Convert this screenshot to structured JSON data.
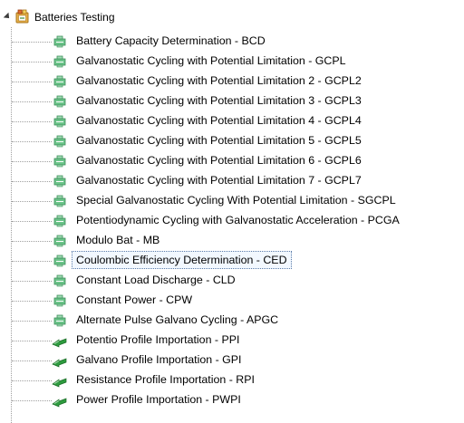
{
  "tree": {
    "root_label": "Batteries Testing",
    "items": [
      {
        "label": "Battery Capacity Determination - BCD",
        "icon": "technique-icon"
      },
      {
        "label": "Galvanostatic Cycling with Potential Limitation - GCPL",
        "icon": "technique-icon"
      },
      {
        "label": "Galvanostatic Cycling with Potential Limitation 2 - GCPL2",
        "icon": "technique-icon"
      },
      {
        "label": "Galvanostatic Cycling with Potential Limitation 3 - GCPL3",
        "icon": "technique-icon"
      },
      {
        "label": "Galvanostatic Cycling with Potential Limitation 4 - GCPL4",
        "icon": "technique-icon"
      },
      {
        "label": "Galvanostatic Cycling with Potential Limitation 5 - GCPL5",
        "icon": "technique-icon"
      },
      {
        "label": "Galvanostatic Cycling with Potential Limitation 6 - GCPL6",
        "icon": "technique-icon"
      },
      {
        "label": "Galvanostatic Cycling with Potential Limitation 7 - GCPL7",
        "icon": "technique-icon"
      },
      {
        "label": "Special Galvanostatic Cycling With Potential Limitation - SGCPL",
        "icon": "technique-icon"
      },
      {
        "label": "Potentiodynamic Cycling with Galvanostatic Acceleration - PCGA",
        "icon": "technique-icon"
      },
      {
        "label": "Modulo Bat - MB",
        "icon": "technique-icon"
      },
      {
        "label": "Coulombic Efficiency Determination - CED",
        "icon": "technique-icon",
        "selected": true
      },
      {
        "label": "Constant Load Discharge - CLD",
        "icon": "technique-icon"
      },
      {
        "label": "Constant Power - CPW",
        "icon": "technique-icon"
      },
      {
        "label": "Alternate Pulse Galvano Cycling - APGC",
        "icon": "technique-icon"
      },
      {
        "label": "Potentio Profile Importation - PPI",
        "icon": "import-icon"
      },
      {
        "label": "Galvano Profile Importation - GPI",
        "icon": "import-icon"
      },
      {
        "label": "Resistance Profile Importation - RPI",
        "icon": "import-icon"
      },
      {
        "label": "Power Profile Importation - PWPI",
        "icon": "import-icon"
      }
    ]
  },
  "colors": {
    "technique_icon": "#6cc48a",
    "import_icon": "#2e9b3f",
    "selection_border": "#5a7ba8",
    "tree_line": "#a0a0a0"
  }
}
